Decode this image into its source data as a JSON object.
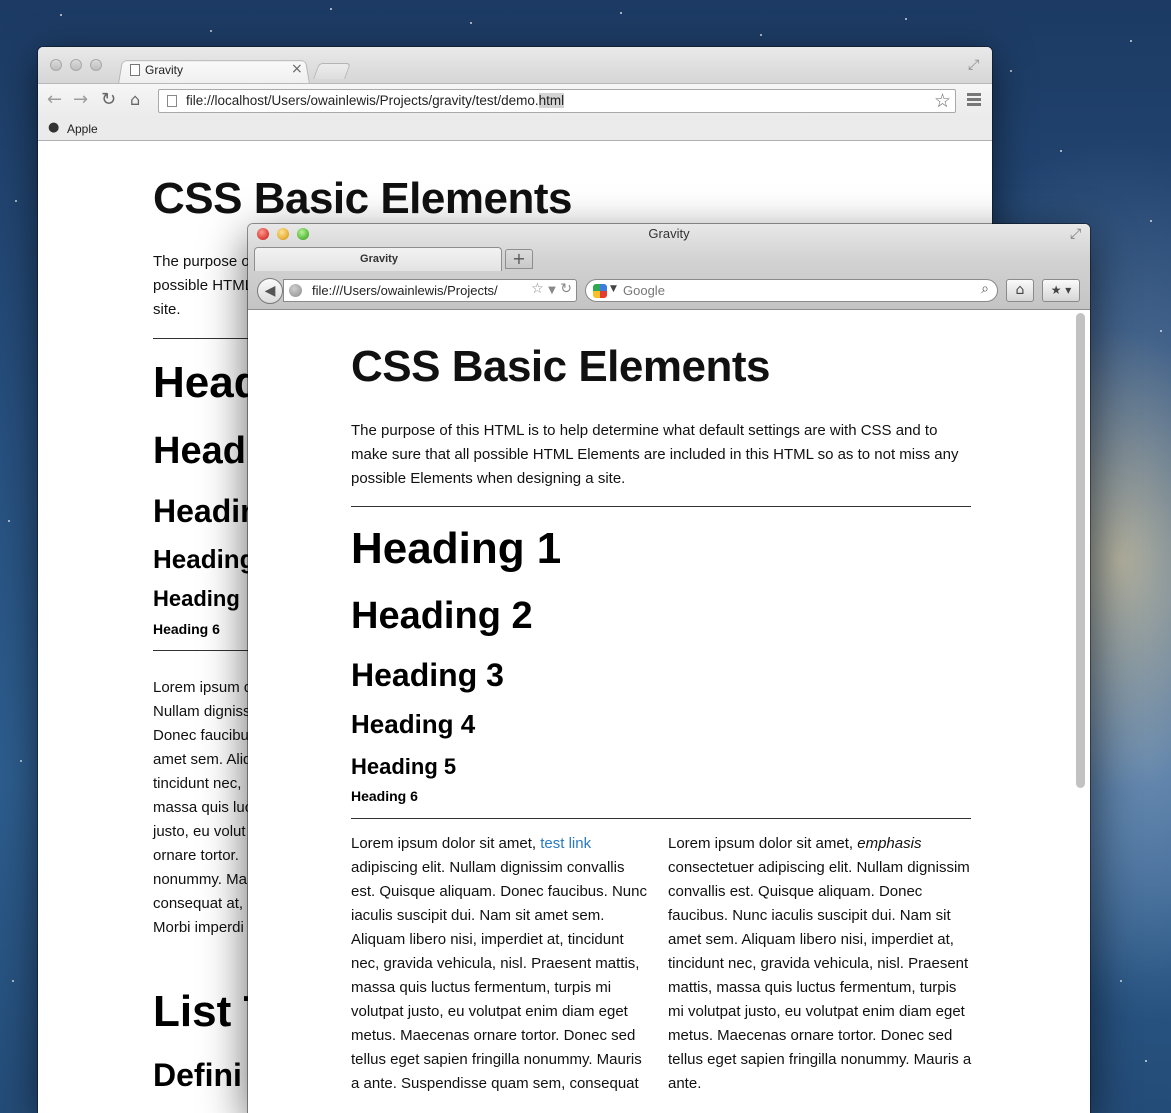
{
  "chrome": {
    "tab_title": "Gravity",
    "tab_close": "×",
    "url_prefix": "file://localhost/Users/owainlewis/Projects/gravity/test/demo.",
    "url_selected": "html",
    "bookmark_label": "Apple",
    "page": {
      "title": "CSS Basic Elements",
      "intro_line1": "The purpose o",
      "intro_line2": "possible HTML",
      "intro_line3": "site.",
      "h1": "Head",
      "h2": "Head",
      "h3": "Heading",
      "h4": "Heading",
      "h5": "Heading",
      "h6": "Heading 6",
      "body_lines": [
        "Lorem ipsum d",
        "Nullam digniss",
        "Donec faucibu",
        "amet sem. Aliq",
        "tincidunt nec,",
        "massa quis luc",
        "justo, eu volut",
        "ornare tortor.",
        "nonummy. Ma",
        "consequat at,",
        "Morbi imperdi"
      ],
      "list_heading": "List T",
      "definition_heading": "Defini"
    }
  },
  "firefox": {
    "window_title": "Gravity",
    "tab_title": "Gravity",
    "new_tab": "+",
    "url": "file:///Users/owainlewis/Projects/",
    "search_placeholder": "Google",
    "page": {
      "title": "CSS Basic Elements",
      "intro": "The purpose of this HTML is to help determine what default settings are with CSS and to make sure that all possible HTML Elements are included in this HTML so as to not miss any possible Elements when designing a site.",
      "h1": "Heading 1",
      "h2": "Heading 2",
      "h3": "Heading 3",
      "h4": "Heading 4",
      "h5": "Heading 5",
      "h6": "Heading 6",
      "col1_before_link": "Lorem ipsum dolor sit amet, ",
      "col1_link": "test link",
      "col1_after_link": " adipiscing elit. Nullam dignissim convallis est. Quisque aliquam. Donec faucibus. Nunc iaculis suscipit dui. Nam sit amet sem. Aliquam libero nisi, imperdiet at, tincidunt nec, gravida vehicula, nisl. Praesent mattis, massa quis luctus fermentum, turpis mi volutpat justo, eu volutpat enim diam eget metus. Maecenas ornare tortor. Donec sed tellus eget sapien fringilla nonummy. Mauris a ante. Suspendisse quam sem, consequat",
      "col2_before_em": "Lorem ipsum dolor sit amet, ",
      "col2_em": "emphasis",
      "col2_after_em": " consectetuer adipiscing elit. Nullam dignissim convallis est. Quisque aliquam. Donec faucibus. Nunc iaculis suscipit dui. Nam sit amet sem. Aliquam libero nisi, imperdiet at, tincidunt nec, gravida vehicula, nisl. Praesent mattis, massa quis luctus fermentum, turpis mi volutpat justo, eu volutpat enim diam eget metus. Maecenas ornare tortor. Donec sed tellus eget sapien fringilla nonummy. Mauris a ante."
    }
  },
  "colors": {
    "link": "#2a78c2",
    "close_light": "#e0463f",
    "minimize_light": "#e8b33a",
    "zoom_light": "#5fbf42"
  }
}
